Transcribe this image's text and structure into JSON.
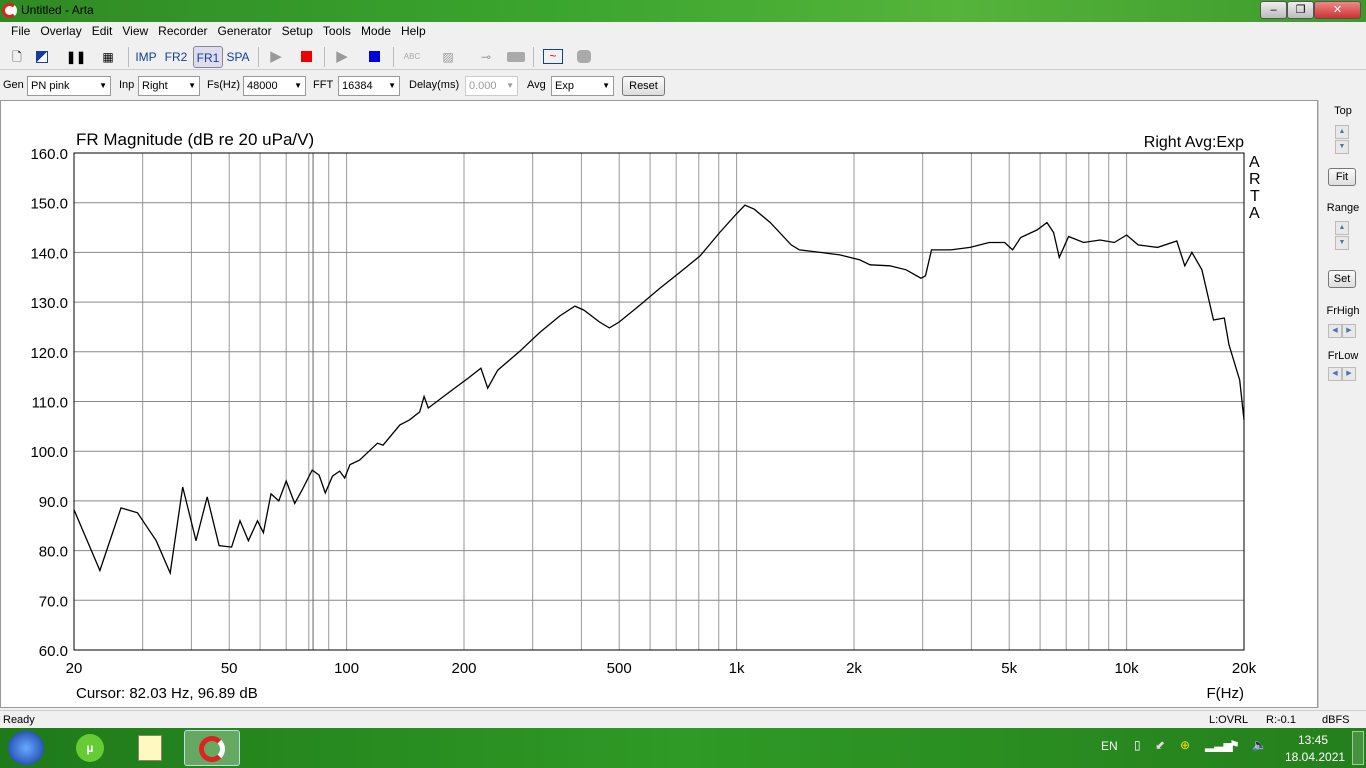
{
  "window": {
    "title": "Untitled - Arta"
  },
  "menu": [
    "File",
    "Overlay",
    "Edit",
    "View",
    "Recorder",
    "Generator",
    "Setup",
    "Tools",
    "Mode",
    "Help"
  ],
  "toolbar": {
    "imp": "IMP",
    "fr2": "FR2",
    "fr1": "FR1",
    "spa": "SPA"
  },
  "controls": {
    "gen_label": "Gen",
    "gen_value": "PN pink",
    "inp_label": "Inp",
    "inp_value": "Right",
    "fs_label": "Fs(Hz)",
    "fs_value": "48000",
    "fft_label": "FFT",
    "fft_value": "16384",
    "delay_label": "Delay(ms)",
    "delay_value": "0.000",
    "avg_label": "Avg",
    "avg_value": "Exp",
    "reset": "Reset"
  },
  "right_panel": {
    "top": "Top",
    "fit": "Fit",
    "range": "Range",
    "set": "Set",
    "frhigh": "FrHigh",
    "frlow": "FrLow"
  },
  "plot": {
    "right_title": "Right Avg:Exp",
    "brand": [
      "A",
      "R",
      "T",
      "A"
    ],
    "cursor": "Cursor: 82.03 Hz, 96.89 dB",
    "cursor_hz": 82.03
  },
  "chart_data": {
    "type": "line",
    "title": "FR Magnitude (dB re 20 uPa/V)",
    "xlabel": "F(Hz)",
    "xscale": "log",
    "xlim": [
      20,
      20000
    ],
    "ylim": [
      60,
      160
    ],
    "grid": true,
    "x_ticks": [
      20,
      50,
      100,
      200,
      500,
      1000,
      2000,
      5000,
      10000,
      20000
    ],
    "x_tick_labels": [
      "20",
      "50",
      "100",
      "200",
      "500",
      "1k",
      "2k",
      "5k",
      "10k",
      "20k"
    ],
    "y_ticks": [
      60,
      70,
      80,
      90,
      100,
      110,
      120,
      130,
      140,
      150,
      160
    ],
    "y_tick_labels": [
      "60.0",
      "70.0",
      "80.0",
      "90.0",
      "100.0",
      "110.0",
      "120.0",
      "130.0",
      "140.0",
      "150.0",
      "160.0"
    ],
    "series": [
      {
        "name": "FR",
        "points": [
          [
            20,
            88.2
          ],
          [
            23.3,
            76
          ],
          [
            26.4,
            88.6
          ],
          [
            29.1,
            87.6
          ],
          [
            32.5,
            82
          ],
          [
            35.3,
            75.5
          ],
          [
            38,
            92.8
          ],
          [
            41.1,
            82
          ],
          [
            43.9,
            90.8
          ],
          [
            47.1,
            81
          ],
          [
            50.7,
            80.7
          ],
          [
            53.3,
            86
          ],
          [
            56,
            82
          ],
          [
            59.1,
            86
          ],
          [
            61.2,
            83.6
          ],
          [
            64,
            91.4
          ],
          [
            67,
            90
          ],
          [
            70,
            94
          ],
          [
            73.6,
            89.5
          ],
          [
            76.9,
            92.2
          ],
          [
            81.6,
            96.2
          ],
          [
            85,
            95.2
          ],
          [
            88.2,
            91.6
          ],
          [
            92,
            95
          ],
          [
            96,
            96
          ],
          [
            98.9,
            94.6
          ],
          [
            102,
            97.3
          ],
          [
            108,
            98.2
          ],
          [
            120,
            101.6
          ],
          [
            124,
            101.2
          ],
          [
            137,
            105.3
          ],
          [
            145,
            106.3
          ],
          [
            154,
            107.9
          ],
          [
            158,
            111
          ],
          [
            162,
            108.7
          ],
          [
            182,
            111.7
          ],
          [
            205,
            114.7
          ],
          [
            221,
            116.7
          ],
          [
            230,
            112.7
          ],
          [
            244,
            116.3
          ],
          [
            277,
            120
          ],
          [
            312,
            123.8
          ],
          [
            352,
            127.2
          ],
          [
            385,
            129.2
          ],
          [
            406,
            128.4
          ],
          [
            445,
            126
          ],
          [
            472,
            124.8
          ],
          [
            500,
            126
          ],
          [
            565,
            129.4
          ],
          [
            636,
            132.8
          ],
          [
            716,
            136
          ],
          [
            806,
            139.3
          ],
          [
            905,
            144
          ],
          [
            993,
            147.5
          ],
          [
            1050,
            149.5
          ],
          [
            1110,
            148.7
          ],
          [
            1220,
            146
          ],
          [
            1380,
            141.5
          ],
          [
            1450,
            140.5
          ],
          [
            1640,
            140
          ],
          [
            1840,
            139.5
          ],
          [
            2070,
            138.5
          ],
          [
            2200,
            137.5
          ],
          [
            2470,
            137.3
          ],
          [
            2720,
            136.5
          ],
          [
            2970,
            134.8
          ],
          [
            3050,
            135.3
          ],
          [
            3160,
            140.5
          ],
          [
            3540,
            140.5
          ],
          [
            3970,
            141
          ],
          [
            4440,
            142
          ],
          [
            4870,
            142
          ],
          [
            5100,
            140.5
          ],
          [
            5350,
            143
          ],
          [
            5890,
            144.5
          ],
          [
            6250,
            146
          ],
          [
            6500,
            144
          ],
          [
            6720,
            139
          ],
          [
            7100,
            143.2
          ],
          [
            7760,
            142
          ],
          [
            8550,
            142.5
          ],
          [
            9300,
            142
          ],
          [
            10000,
            143.5
          ],
          [
            10700,
            141.5
          ],
          [
            12000,
            141
          ],
          [
            13450,
            142.3
          ],
          [
            14100,
            137.3
          ],
          [
            14700,
            140
          ],
          [
            15600,
            136.5
          ],
          [
            16700,
            126.4
          ],
          [
            17800,
            126.8
          ],
          [
            18300,
            121.4
          ],
          [
            19500,
            114.3
          ],
          [
            20000,
            106.3
          ]
        ]
      }
    ]
  },
  "status": {
    "left": "Ready",
    "l": "L:OVRL",
    "r": "R:-0.1",
    "unit": "dBFS"
  },
  "taskbar": {
    "lang": "EN",
    "time": "13:45",
    "date": "18.04.2021"
  }
}
